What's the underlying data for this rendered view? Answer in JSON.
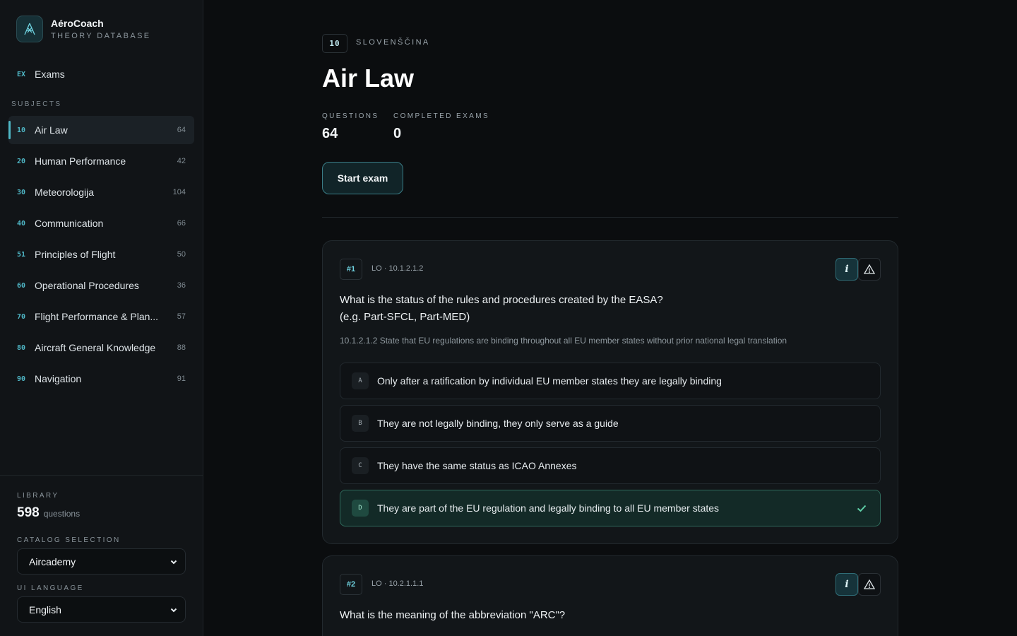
{
  "brand": {
    "name": "AéroCoach",
    "subtitle": "THEORY DATABASE"
  },
  "nav": {
    "exams": {
      "code": "EX",
      "label": "Exams"
    }
  },
  "sidebar": {
    "section_title": "SUBJECTS",
    "subjects": [
      {
        "code": "10",
        "label": "Air Law",
        "count": "64",
        "active": true
      },
      {
        "code": "20",
        "label": "Human Performance",
        "count": "42"
      },
      {
        "code": "30",
        "label": "Meteorologija",
        "count": "104"
      },
      {
        "code": "40",
        "label": "Communication",
        "count": "66"
      },
      {
        "code": "51",
        "label": "Principles of Flight",
        "count": "50"
      },
      {
        "code": "60",
        "label": "Operational Procedures",
        "count": "36"
      },
      {
        "code": "70",
        "label": "Flight Performance & Plan...",
        "count": "57"
      },
      {
        "code": "80",
        "label": "Aircraft General Knowledge",
        "count": "88"
      },
      {
        "code": "90",
        "label": "Navigation",
        "count": "91"
      }
    ]
  },
  "footer": {
    "library_label": "LIBRARY",
    "library_count": "598",
    "library_unit": "questions",
    "catalog_label": "CATALOG SELECTION",
    "catalog_value": "Aircademy",
    "language_label": "UI LANGUAGE",
    "language_value": "English"
  },
  "header": {
    "code": "10",
    "language": "SLOVENŠČINA",
    "title": "Air Law",
    "questions_label": "QUESTIONS",
    "questions_value": "64",
    "completed_label": "COMPLETED EXAMS",
    "completed_value": "0",
    "start_button": "Start exam"
  },
  "questions": [
    {
      "number": "#1",
      "lo": "LO · 10.1.2.1.2",
      "text_line1": "What is the status of the rules and procedures created by the EASA?",
      "text_line2": "(e.g. Part-SFCL, Part-MED)",
      "objective": "10.1.2.1.2 State that EU regulations are binding throughout all EU member states without prior national legal translation",
      "answers": [
        {
          "letter": "A",
          "text": "Only after a ratification by individual EU member states they are legally binding"
        },
        {
          "letter": "B",
          "text": "They are not legally binding, they only serve as a guide"
        },
        {
          "letter": "C",
          "text": "They have the same status as ICAO Annexes"
        },
        {
          "letter": "D",
          "text": "They are part of the EU regulation and legally binding to all EU member states",
          "correct": true
        }
      ]
    },
    {
      "number": "#2",
      "lo": "LO · 10.2.1.1.1",
      "text_line1": "What is the meaning of the abbreviation \"ARC\"?"
    }
  ],
  "icons": {
    "logo": "aircraft-logo-icon",
    "info": "info-icon",
    "warning": "warning-icon",
    "check": "check-icon",
    "chevron": "chevron-down-icon"
  },
  "colors": {
    "accent": "#4fb7c6",
    "correct": "#2f6b5c",
    "background": "#0b0d0f"
  }
}
